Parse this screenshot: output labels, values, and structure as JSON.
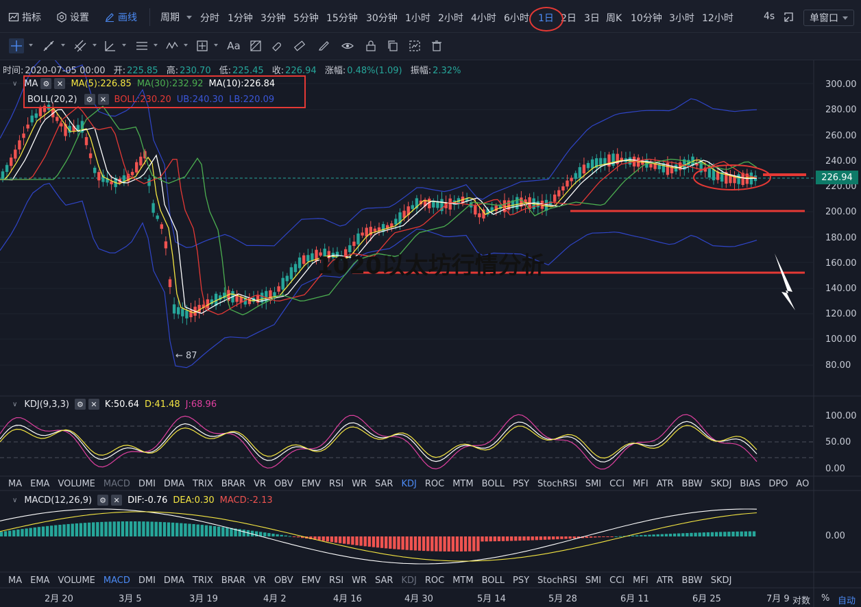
{
  "toolbar": {
    "indicator_label": "指标",
    "settings_label": "设置",
    "draw_label": "画线",
    "period_label": "周期",
    "periods": [
      "分时",
      "1分钟",
      "3分钟",
      "5分钟",
      "15分钟",
      "30分钟",
      "1小时",
      "2小时",
      "4小时",
      "6小时",
      "1日",
      "2日",
      "3日",
      "周K",
      "10分钟",
      "3小时",
      "12小时"
    ],
    "active_period": "1日",
    "refresh_label": "4s",
    "window_mode": "单窗口"
  },
  "ohlc": {
    "time_label": "时间:",
    "time": "2020-07-05 00:00",
    "open_label": "开:",
    "open": "225.85",
    "high_label": "高:",
    "high": "230.70",
    "low_label": "低:",
    "low": "225.45",
    "close_label": "收:",
    "close": "226.94",
    "change_label": "涨幅:",
    "change": "0.48%(1.09)",
    "amplitude_label": "振幅:",
    "amplitude": "2.32%"
  },
  "ma_legend": {
    "name": "MA",
    "ma5": "MA(5):226.85",
    "ma30": "MA(30):232.92",
    "ma10": "MA(10):226.84"
  },
  "boll_legend": {
    "name": "BOLL(20,2)",
    "boll": "BOLL:230.20",
    "ub": "UB:240.30",
    "lb": "LB:220.09"
  },
  "kdj_legend": {
    "name": "KDJ(9,3,3)",
    "k": "K:50.64",
    "d": "D:41.48",
    "j": "J:68.96"
  },
  "macd_legend": {
    "name": "MACD(12,26,9)",
    "dif": "DIF:-0.76",
    "dea": "DEA:0.30",
    "macd": "MACD:-2.13"
  },
  "indicator_tabs_1": [
    "MA",
    "EMA",
    "VOLUME",
    "MACD",
    "DMI",
    "DMA",
    "TRIX",
    "BRAR",
    "VR",
    "OBV",
    "EMV",
    "RSI",
    "WR",
    "SAR",
    "KDJ",
    "ROC",
    "MTM",
    "BOLL",
    "PSY",
    "StochRSI",
    "SMI",
    "CCI",
    "MFI",
    "ATR",
    "BBW",
    "SKDJ",
    "BIAS",
    "DPO",
    "AO"
  ],
  "indicator_tabs_2": [
    "MA",
    "EMA",
    "VOLUME",
    "MACD",
    "DMI",
    "DMA",
    "TRIX",
    "BRAR",
    "VR",
    "OBV",
    "EMV",
    "RSI",
    "WR",
    "SAR",
    "KDJ",
    "ROC",
    "MTM",
    "BOLL",
    "PSY",
    "StochRSI",
    "SMI",
    "CCI",
    "MFI",
    "ATR",
    "BBW",
    "SKDJ"
  ],
  "price_axis": [
    "300.00",
    "280.00",
    "260.00",
    "240.00",
    "220.00",
    "200.00",
    "180.00",
    "160.00",
    "140.00",
    "120.00",
    "100.00",
    "80.00"
  ],
  "current_price": "226.94",
  "kdj_axis": [
    "100.00",
    "50.00",
    "0.00"
  ],
  "macd_axis": [
    "0.00"
  ],
  "date_axis": [
    "2月 20",
    "3月 5",
    "3月 19",
    "4月 2",
    "4月 16",
    "4月 30",
    "5月 14",
    "5月 28",
    "6月 11",
    "6月 25",
    "7月 9"
  ],
  "low_marker": "← 87",
  "footer": {
    "log_label": "对数",
    "pct_label": "%",
    "auto_label": "自动"
  },
  "watermark": "1020以太坊行情分析",
  "colors": {
    "up": "#26a69a",
    "down": "#ef5350",
    "ma5": "#f5e642",
    "ma10": "#ffffff",
    "ma30": "#4caf50",
    "boll": "#e53935",
    "band": "#2f45c8",
    "accent": "#4c8bf5",
    "annotation": "#e53935"
  }
}
